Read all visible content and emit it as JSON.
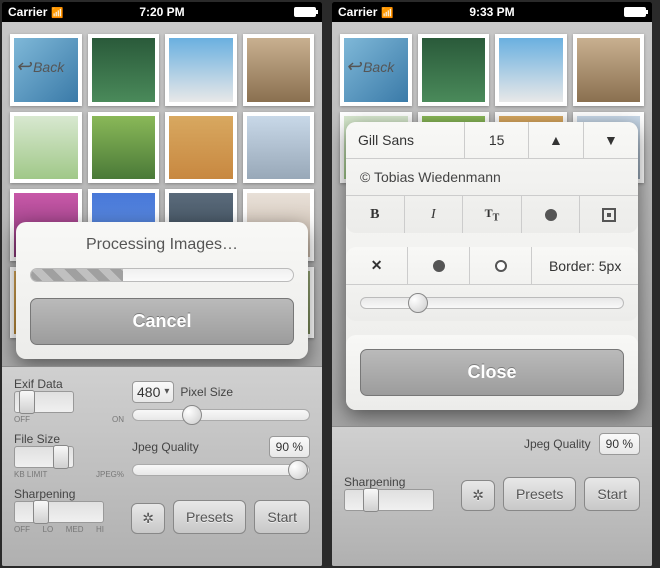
{
  "left": {
    "status": {
      "carrier": "Carrier",
      "time": "7:20 PM"
    },
    "back_label": "Back",
    "modal": {
      "title": "Processing Images…",
      "cancel_label": "Cancel"
    },
    "panel": {
      "exif_label": "Exif Data",
      "exif_off": "OFF",
      "exif_on": "ON",
      "pixel_label": "Pixel Size",
      "pixel_value": "480",
      "filesize_label": "File Size",
      "fs_t1": "KB LIMIT",
      "fs_t2": "JPEG%",
      "jpeg_label": "Jpeg Quality",
      "jpeg_value": "90 %",
      "sharpen_label": "Sharpening",
      "sh_t0": "OFF",
      "sh_t1": "LO",
      "sh_t2": "MED",
      "sh_t3": "HI",
      "presets_label": "Presets",
      "start_label": "Start"
    }
  },
  "right": {
    "status": {
      "carrier": "Carrier",
      "time": "9:33 PM"
    },
    "back_label": "Back",
    "text_panel": {
      "font_name": "Gill Sans",
      "font_size": "15",
      "credit": "© Tobias Wiedenmann",
      "bold": "B",
      "italic": "I",
      "tt": "TT",
      "border_label": "Border: 5px",
      "close_label": "Close"
    },
    "panel": {
      "jpeg_label": "Jpeg Quality",
      "jpeg_value": "90 %",
      "sharpen_label": "Sharpening",
      "presets_label": "Presets",
      "start_label": "Start"
    }
  }
}
